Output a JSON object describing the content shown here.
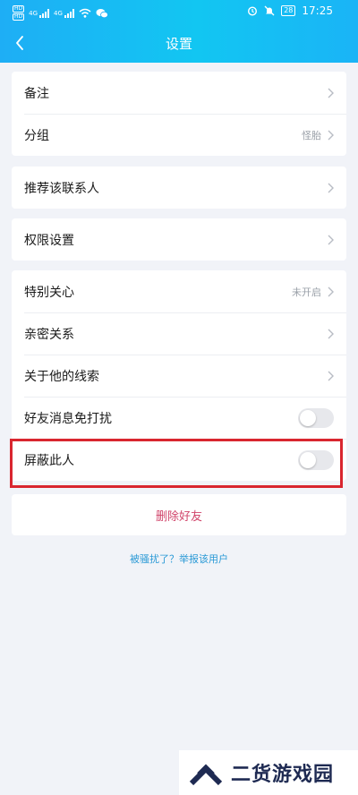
{
  "status_bar": {
    "sim1": "HD",
    "sim2": "HD",
    "net1": "4G",
    "net2": "4G",
    "battery": "28",
    "time": "17:25"
  },
  "header": {
    "title": "设置"
  },
  "groups": [
    {
      "items": [
        {
          "label": "备注",
          "value": ""
        },
        {
          "label": "分组",
          "value": "怪胎"
        }
      ]
    },
    {
      "items": [
        {
          "label": "推荐该联系人",
          "value": ""
        }
      ]
    },
    {
      "items": [
        {
          "label": "权限设置",
          "value": ""
        }
      ]
    },
    {
      "items": [
        {
          "label": "特别关心",
          "value": "未开启"
        },
        {
          "label": "亲密关系",
          "value": ""
        },
        {
          "label": "关于他的线索",
          "value": ""
        },
        {
          "label": "好友消息免打扰",
          "toggle": false
        },
        {
          "label": "屏蔽此人",
          "toggle": false
        }
      ]
    }
  ],
  "delete_label": "删除好友",
  "report_link": "被骚扰了？举报该用户",
  "watermark": {
    "text": "二货游戏园"
  },
  "colors": {
    "header_start": "#1eaef5",
    "header_end": "#12c6f2",
    "danger": "#d1456b",
    "link": "#2b9ad6",
    "highlight": "#d9262f"
  }
}
